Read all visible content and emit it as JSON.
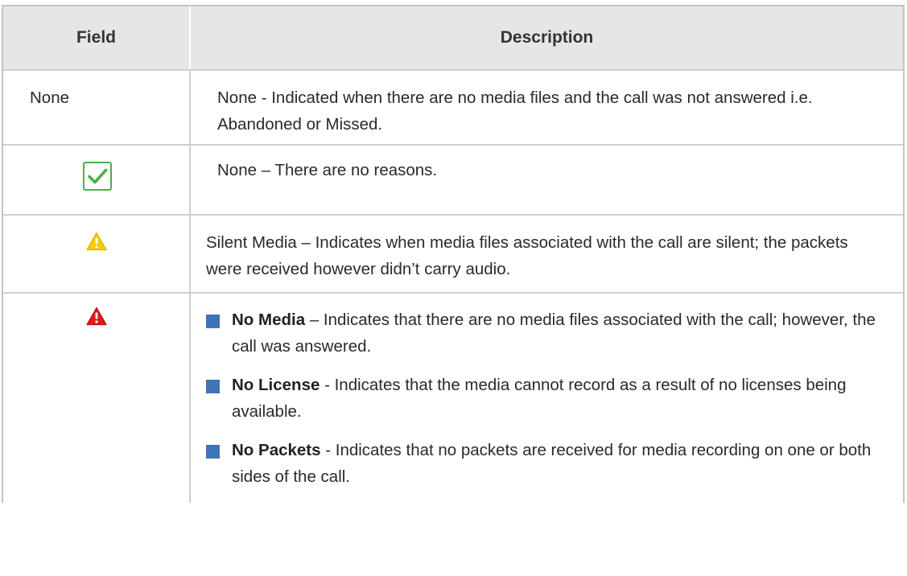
{
  "header": {
    "field": "Field",
    "description": "Description"
  },
  "rows": [
    {
      "field": "None",
      "description": "None - Indicated when there are no media files and the call was not answered i.e. Abandoned or Missed."
    },
    {
      "icon": "check-icon",
      "description": "None – There are no reasons."
    },
    {
      "icon": "warning-yellow-icon",
      "description": "Silent Media – Indicates when media files associated with the call are silent; the packets were received however didn’t carry audio."
    },
    {
      "icon": "warning-red-icon",
      "bullets": [
        {
          "term": "No Media",
          "text": " – Indicates that there are no media files associated with the call; however, the call was answered."
        },
        {
          "term": "No License",
          "text": " - Indicates that the media cannot record as a result of no licenses being available."
        },
        {
          "term": "No Packets",
          "text": " - Indicates that no packets are received for media recording on one or both sides of the call."
        }
      ]
    }
  ],
  "colors": {
    "check": "#49b04a",
    "warning": "#f2c800",
    "alert": "#e01b1b",
    "bullet": "#3e74b4",
    "header_bg": "#e6e6e6"
  }
}
